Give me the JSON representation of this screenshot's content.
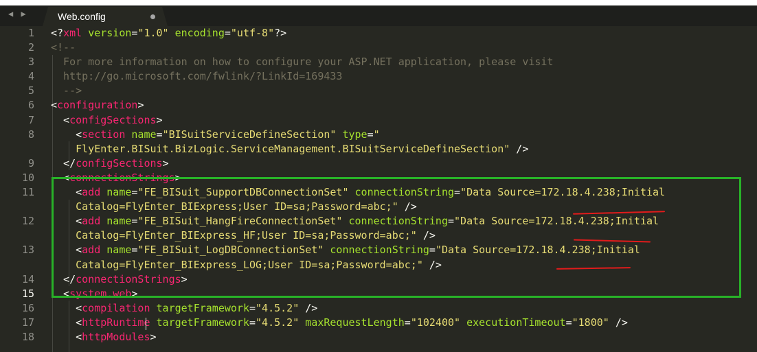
{
  "tab": {
    "nav_arrows": "◀ ▶",
    "title": "Web.config"
  },
  "lines": [
    {
      "num": "1",
      "parts": [
        [
          "t",
          "<?"
        ],
        [
          "tag",
          "xml"
        ],
        [
          "t",
          " "
        ],
        [
          "attr",
          "version"
        ],
        [
          "t",
          "="
        ],
        [
          "str",
          "\"1.0\""
        ],
        [
          "t",
          " "
        ],
        [
          "attr",
          "encoding"
        ],
        [
          "t",
          "="
        ],
        [
          "str",
          "\"utf-8\""
        ],
        [
          "t",
          "?>"
        ]
      ]
    },
    {
      "num": "2",
      "parts": [
        [
          "cmt",
          "<!--"
        ]
      ]
    },
    {
      "num": "3",
      "parts": [
        [
          "cmt",
          "  For more information on how to configure your ASP.NET application, please visit"
        ]
      ]
    },
    {
      "num": "4",
      "parts": [
        [
          "cmt",
          "  http://go.microsoft.com/fwlink/?LinkId=169433"
        ]
      ]
    },
    {
      "num": "5",
      "parts": [
        [
          "cmt",
          "  -->"
        ]
      ]
    },
    {
      "num": "6",
      "parts": [
        [
          "t",
          "<"
        ],
        [
          "tag",
          "configuration"
        ],
        [
          "t",
          ">"
        ]
      ]
    },
    {
      "num": "7",
      "parts": [
        [
          "t",
          "  <"
        ],
        [
          "tag",
          "configSections"
        ],
        [
          "t",
          ">"
        ]
      ]
    },
    {
      "num": "8",
      "parts": [
        [
          "t",
          "    <"
        ],
        [
          "tag",
          "section"
        ],
        [
          "t",
          " "
        ],
        [
          "attr",
          "name"
        ],
        [
          "t",
          "="
        ],
        [
          "str",
          "\"BISuitServiceDefineSection\""
        ],
        [
          "t",
          " "
        ],
        [
          "attr",
          "type"
        ],
        [
          "t",
          "="
        ],
        [
          "str",
          "\""
        ]
      ]
    },
    {
      "num": "",
      "parts": [
        [
          "str",
          "    FlyEnter.BISuit.BizLogic.ServiceManagement.BISuitServiceDefineSection\""
        ],
        [
          "t",
          " />"
        ]
      ]
    },
    {
      "num": "9",
      "parts": [
        [
          "t",
          "  </"
        ],
        [
          "tag",
          "configSections"
        ],
        [
          "t",
          ">"
        ]
      ]
    },
    {
      "num": "10",
      "parts": [
        [
          "t",
          "  <"
        ],
        [
          "tag",
          "connectionStrings"
        ],
        [
          "t",
          ">"
        ]
      ]
    },
    {
      "num": "11",
      "parts": [
        [
          "t",
          "    <"
        ],
        [
          "tag",
          "add"
        ],
        [
          "t",
          " "
        ],
        [
          "attr",
          "name"
        ],
        [
          "t",
          "="
        ],
        [
          "str",
          "\"FE_BISuit_SupportDBConnectionSet\""
        ],
        [
          "t",
          " "
        ],
        [
          "attr",
          "connectionString"
        ],
        [
          "t",
          "="
        ],
        [
          "str",
          "\"Data Source=172.18.4.238;Initial"
        ]
      ]
    },
    {
      "num": "",
      "parts": [
        [
          "str",
          "    Catalog=FlyEnter_BIExpress;User ID=sa;Password=abc;\""
        ],
        [
          "t",
          " />"
        ]
      ]
    },
    {
      "num": "12",
      "parts": [
        [
          "t",
          "    <"
        ],
        [
          "tag",
          "add"
        ],
        [
          "t",
          " "
        ],
        [
          "attr",
          "name"
        ],
        [
          "t",
          "="
        ],
        [
          "str",
          "\"FE_BISuit_HangFireConnectionSet\""
        ],
        [
          "t",
          " "
        ],
        [
          "attr",
          "connectionString"
        ],
        [
          "t",
          "="
        ],
        [
          "str",
          "\"Data Source=172.18.4.238;Initial"
        ]
      ]
    },
    {
      "num": "",
      "parts": [
        [
          "str",
          "    Catalog=FlyEnter_BIExpress_HF;User ID=sa;Password=abc;\""
        ],
        [
          "t",
          " />"
        ]
      ]
    },
    {
      "num": "13",
      "parts": [
        [
          "t",
          "    <"
        ],
        [
          "tag",
          "add"
        ],
        [
          "t",
          " "
        ],
        [
          "attr",
          "name"
        ],
        [
          "t",
          "="
        ],
        [
          "str",
          "\"FE_BISuit_LogDBConnectionSet\""
        ],
        [
          "t",
          " "
        ],
        [
          "attr",
          "connectionString"
        ],
        [
          "t",
          "="
        ],
        [
          "str",
          "\"Data Source=172.18.4.238;Initial"
        ]
      ]
    },
    {
      "num": "",
      "parts": [
        [
          "str",
          "    Catalog=FlyEnter_BIExpress_LOG;User ID=sa;Password=abc;\""
        ],
        [
          "t",
          " />"
        ]
      ]
    },
    {
      "num": "14",
      "parts": [
        [
          "t",
          "  </"
        ],
        [
          "tag",
          "connectionStrings"
        ],
        [
          "t",
          ">"
        ]
      ]
    },
    {
      "num": "15",
      "current": true,
      "parts": [
        [
          "t",
          "  <"
        ],
        [
          "tag",
          "system.web"
        ],
        [
          "t",
          ">"
        ]
      ]
    },
    {
      "num": "16",
      "parts": [
        [
          "t",
          "    <"
        ],
        [
          "tag",
          "compilation"
        ],
        [
          "t",
          " "
        ],
        [
          "attr",
          "targetFramework"
        ],
        [
          "t",
          "="
        ],
        [
          "str",
          "\"4.5.2\""
        ],
        [
          "t",
          " />"
        ]
      ]
    },
    {
      "num": "17",
      "parts": [
        [
          "t",
          "    <"
        ],
        [
          "tag",
          "httpRuntime"
        ],
        [
          "t",
          " "
        ],
        [
          "attr",
          "targetFramework"
        ],
        [
          "t",
          "="
        ],
        [
          "str",
          "\"4.5.2\""
        ],
        [
          "t",
          " "
        ],
        [
          "attr",
          "maxRequestLength"
        ],
        [
          "t",
          "="
        ],
        [
          "str",
          "\"102400\""
        ],
        [
          "t",
          " "
        ],
        [
          "attr",
          "executionTimeout"
        ],
        [
          "t",
          "="
        ],
        [
          "str",
          "\"1800\""
        ],
        [
          "t",
          " />"
        ]
      ]
    },
    {
      "num": "18",
      "parts": [
        [
          "t",
          "    <"
        ],
        [
          "tag",
          "httpModules"
        ],
        [
          "t",
          ">"
        ]
      ]
    }
  ],
  "colors": {
    "background": "#272822",
    "tag": "#f92672",
    "attribute": "#a6e22e",
    "string": "#e6db74",
    "comment": "#75715e",
    "highlight_box": "#28b228",
    "underline": "#e21b1b"
  }
}
